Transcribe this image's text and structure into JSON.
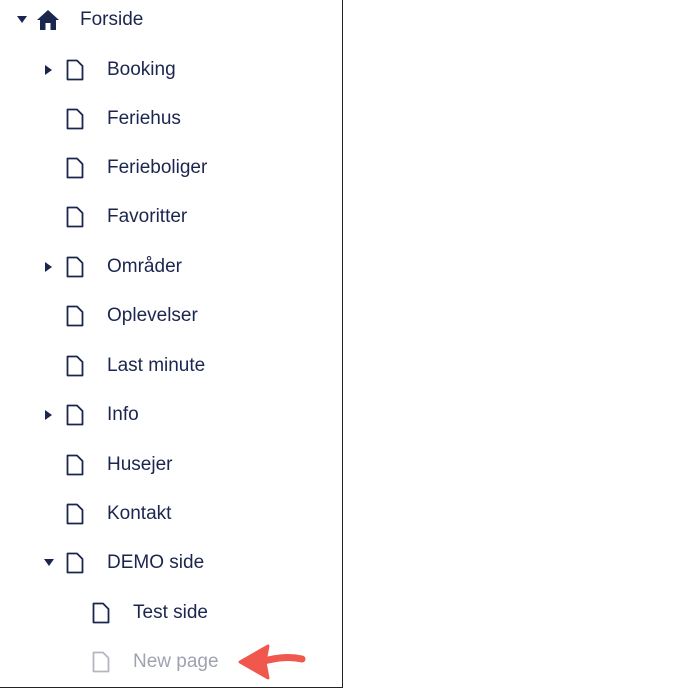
{
  "tree": {
    "root": {
      "label": "Forside",
      "icon": "home-icon",
      "expanded": true
    },
    "items": [
      {
        "label": "Booking",
        "icon": "document-icon",
        "has_children": true,
        "expanded": false
      },
      {
        "label": "Feriehus",
        "icon": "document-icon",
        "has_children": false
      },
      {
        "label": "Ferieboliger",
        "icon": "document-icon",
        "has_children": false
      },
      {
        "label": "Favoritter",
        "icon": "document-icon",
        "has_children": false
      },
      {
        "label": "Områder",
        "icon": "document-icon",
        "has_children": true,
        "expanded": false
      },
      {
        "label": "Oplevelser",
        "icon": "document-icon",
        "has_children": false
      },
      {
        "label": "Last minute",
        "icon": "document-icon",
        "has_children": false
      },
      {
        "label": "Info",
        "icon": "document-icon",
        "has_children": true,
        "expanded": false
      },
      {
        "label": "Husejer",
        "icon": "document-icon",
        "has_children": false
      },
      {
        "label": "Kontakt",
        "icon": "document-icon",
        "has_children": false
      },
      {
        "label": "DEMO side",
        "icon": "document-icon",
        "has_children": true,
        "expanded": true
      },
      {
        "label": "Test side",
        "icon": "document-icon",
        "has_children": false
      },
      {
        "label": "New page",
        "icon": "document-icon",
        "has_children": false,
        "state": "new-unsaved"
      }
    ]
  },
  "colors": {
    "text": "#1b264f",
    "ghost_text": "#9fa2b0",
    "annotation_arrow": "#f0574d"
  }
}
